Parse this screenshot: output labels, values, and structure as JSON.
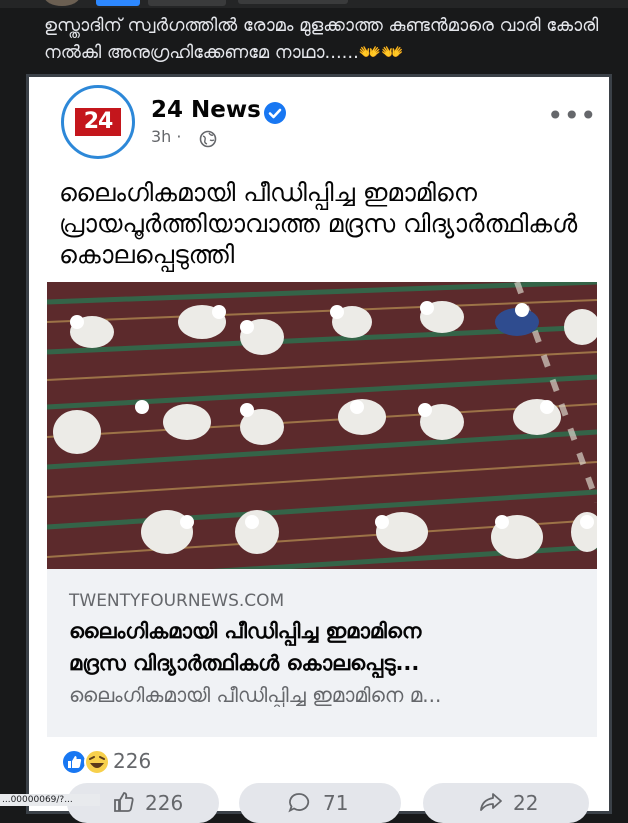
{
  "comment": {
    "text": "ഉസ്താദിന് സ്വർഗത്തിൽ രോമം മുളക്കാത്ത കുണ്ടൻമാരെ വാരി കോരി നൽകി അനുഗ്രഹിക്കേണമേ നാഥാ......👐👐"
  },
  "post": {
    "page_name": "24 News",
    "logo_text": "24",
    "time": "3h",
    "dot": "·",
    "headline": "ലൈംഗികമായി പീഡിപ്പിച്ച ഇമാമിനെ പ്രായപൂർത്തിയാവാത്ത മദ്രസ വിദ്യാർത്ഥികൾ കൊലപ്പെടുത്തി",
    "link": {
      "domain": "TWENTYFOURNEWS.COM",
      "title_line1": "ലൈംഗികമായി പീഡിപ്പിച്ച ഇമാമിനെ",
      "title_line2": "മദ്രസ വിദ്യാർത്ഥികൾ കൊലപ്പെടു...",
      "description": "ലൈംഗികമായി പീഡിപ്പിച്ച ഇമാമിനെ മ..."
    },
    "reactions": {
      "count": "226",
      "types": [
        "like-icon",
        "haha-icon"
      ]
    },
    "actions": {
      "like_count": "226",
      "comment_count": "71",
      "share_count": "22"
    }
  },
  "status_url": "...00000069/?..."
}
